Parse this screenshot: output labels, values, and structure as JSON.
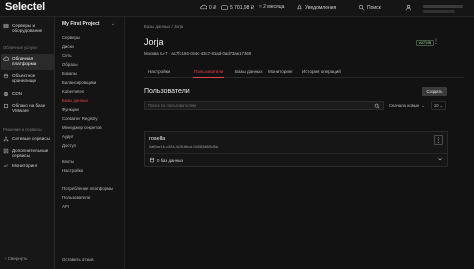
{
  "topbar": {
    "logo": "Selectel",
    "notif_count": "0 ₽",
    "balance": "5 701,98 ₽",
    "period": "≈ 2 месяца",
    "notifications": "Уведомления",
    "search": "Поиск"
  },
  "left_sidebar": {
    "items": [
      {
        "label": "Серверы и оборудование"
      },
      {
        "label": "Облачная платформа"
      },
      {
        "label": "Объектное хранилище"
      },
      {
        "label": "CDN"
      },
      {
        "label": "Облако на базе VMware"
      },
      {
        "label": "Сетевые сервисы"
      },
      {
        "label": "Дополнительные сервисы"
      },
      {
        "label": "Мониторинг"
      }
    ],
    "section_products": "Облачные услуги",
    "section_other": "Решения и сервисы",
    "collapse": "Свернуть"
  },
  "project_sidebar": {
    "title": "My First Project",
    "links": [
      "Серверы",
      "Диски",
      "Сеть",
      "Образы",
      "Бэкапы",
      "Балансировщики",
      "Kubernetes",
      "Базы данных",
      "Функции",
      "Container Registry",
      "Менеджер секретов",
      "Аудит",
      "Доступ"
    ],
    "active_link": "Базы данных",
    "links2": [
      "Квоты",
      "Настройки"
    ],
    "links3": [
      "Потребление платформы",
      "Пользователи",
      "API"
    ],
    "bottom": "Оставить отзыв"
  },
  "main": {
    "breadcrumb": "Базы данных  /  Jorja",
    "title": "Jorja",
    "subtitle": "Москва ru-7  ·  ac7fc194-c64c-43c7-81ad-0ad73ae17369",
    "badge": "АКТИВ",
    "tabs": [
      "Настройки",
      "Пользователи",
      "Базы данных",
      "Мониторинг",
      "История операций"
    ],
    "section_title": "Пользователи",
    "create_button": "Создать",
    "search_placeholder": "Поиск по пользователям",
    "sort_label": "Сначала новые",
    "per_page": "10",
    "user": {
      "name": "rosella",
      "id": "0af0ae1b-c32d-4c3f-8bcd-04583d8f5d5a",
      "db_count": "0 баз данных"
    }
  },
  "colors": {
    "accent": "#e0424e",
    "background": "#121212"
  }
}
